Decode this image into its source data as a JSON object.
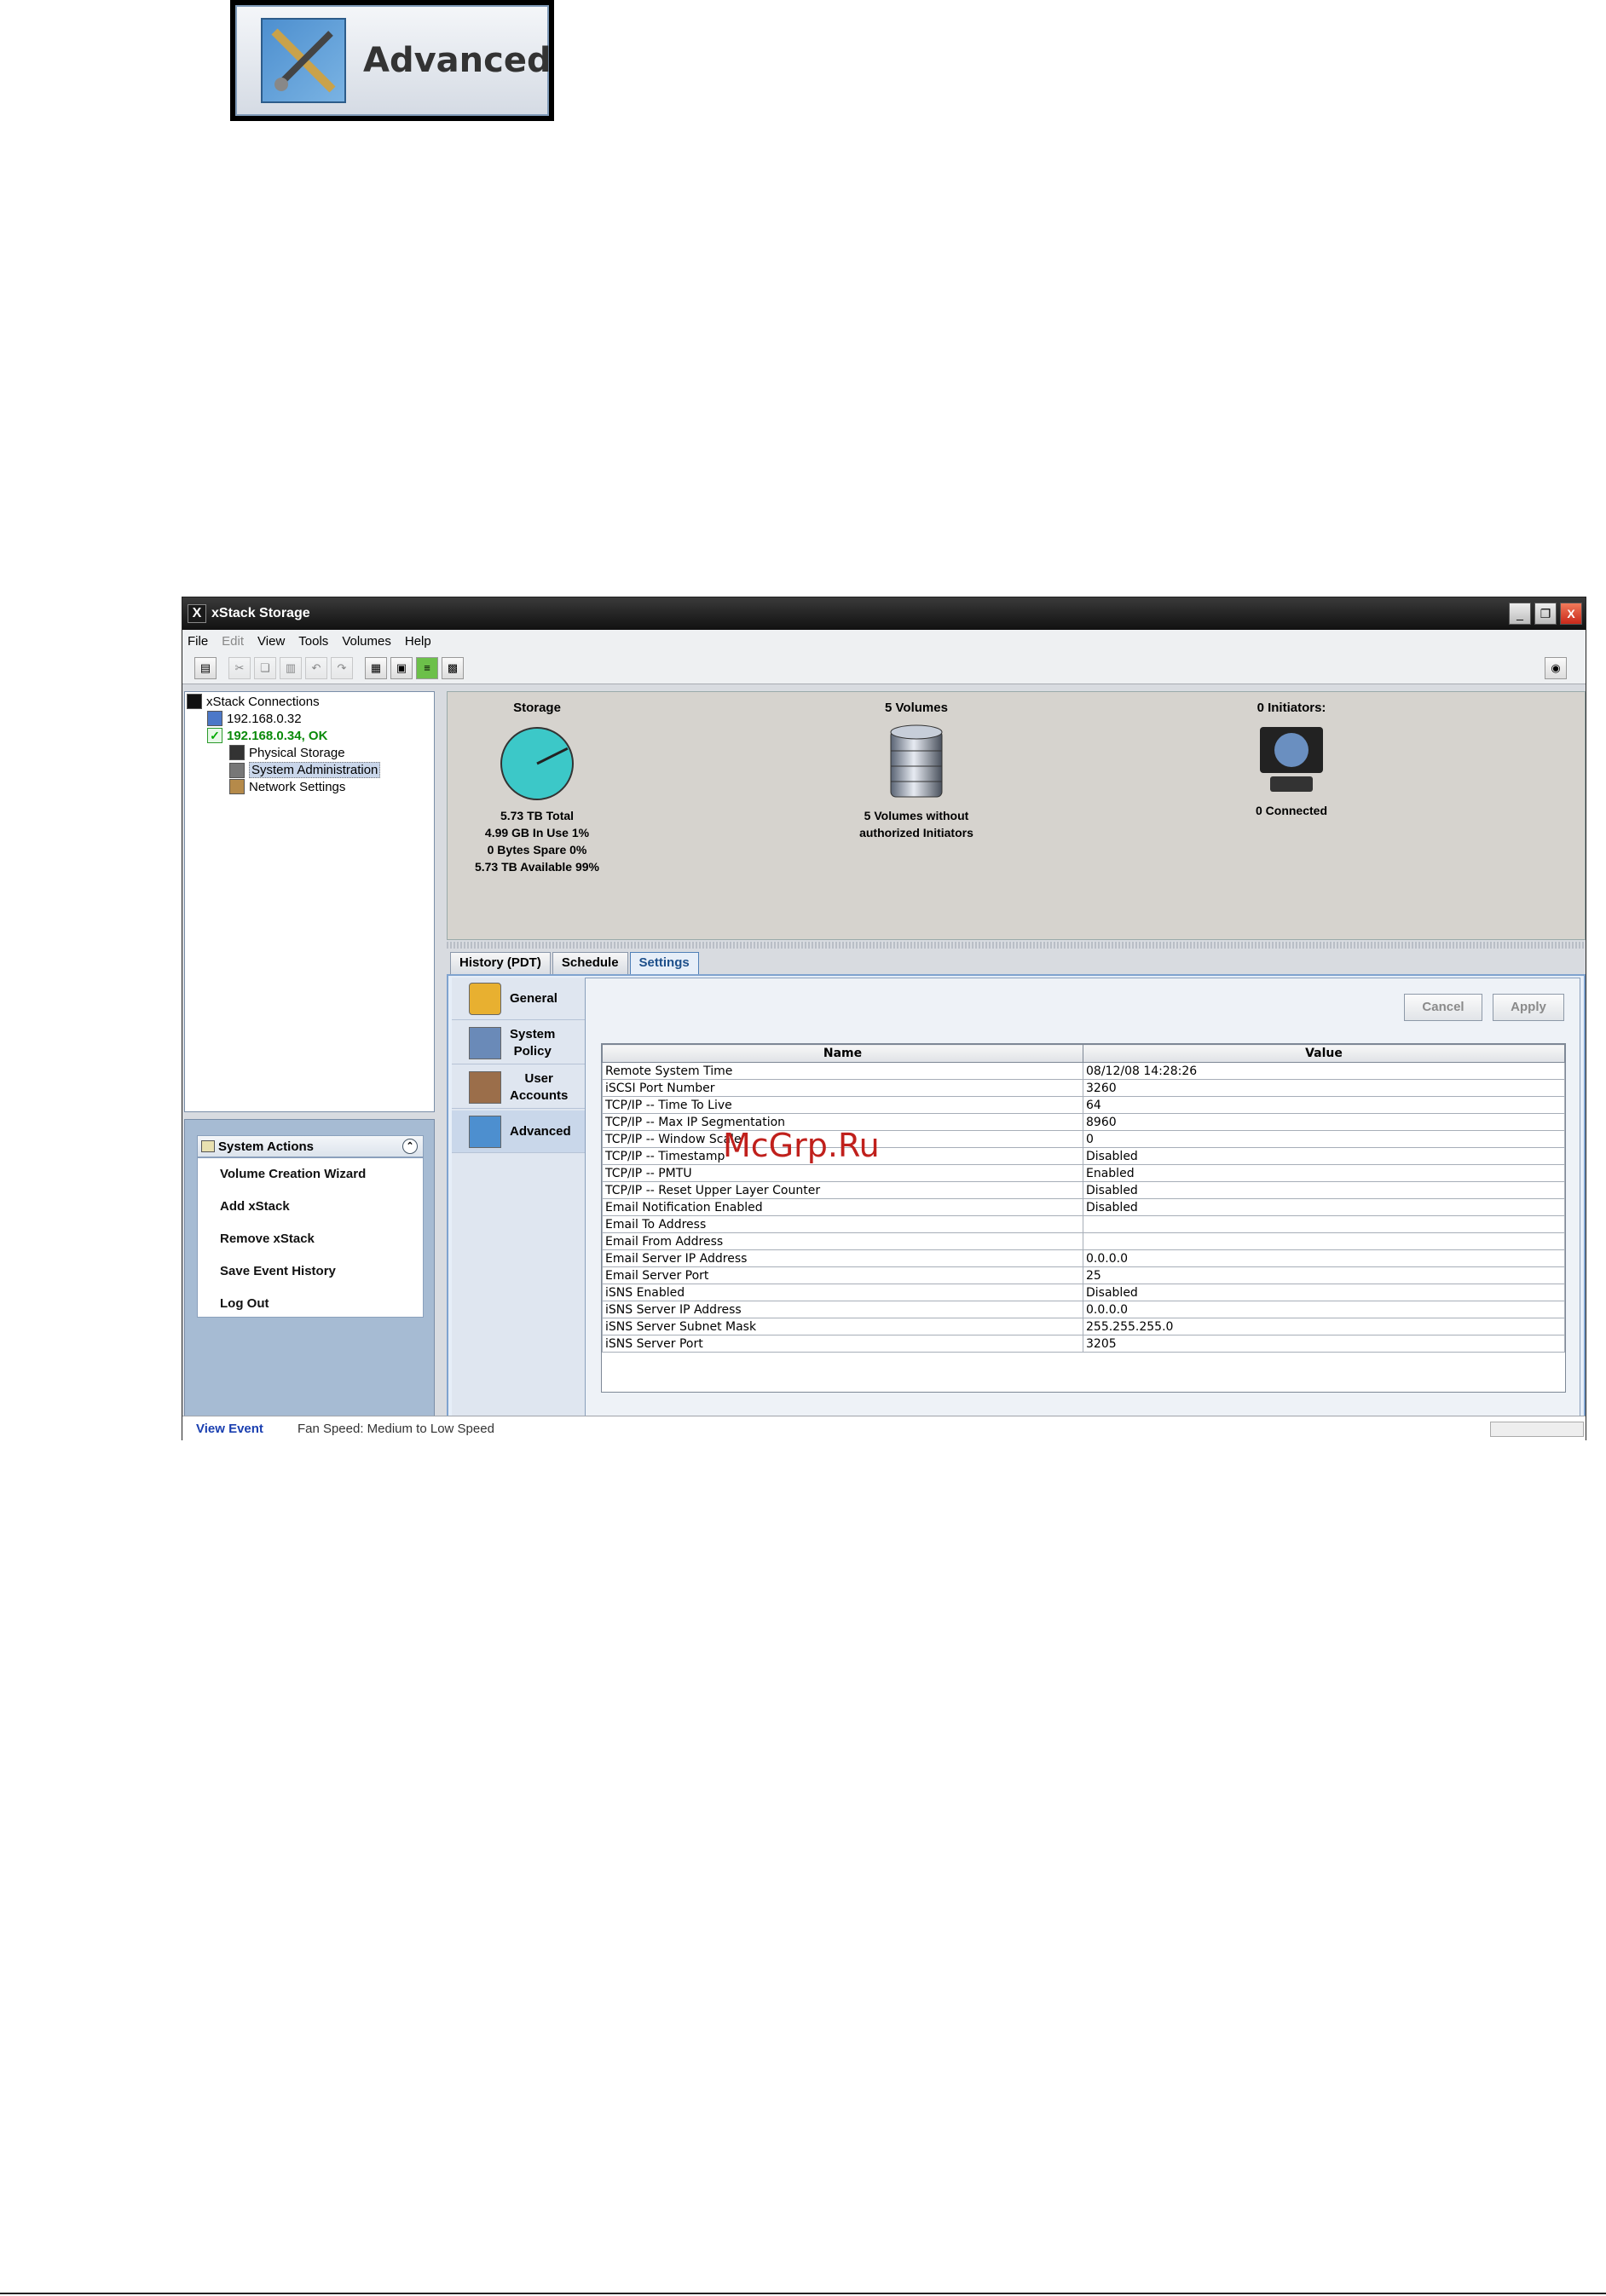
{
  "badge": {
    "label": "Advanced",
    "icon": "tools-icon"
  },
  "window": {
    "title": "xStack Storage",
    "minimize": "_",
    "maximize": "❐",
    "close": "X"
  },
  "menu": {
    "file": "File",
    "edit": "Edit",
    "view": "View",
    "tools": "Tools",
    "volumes": "Volumes",
    "help": "Help"
  },
  "tree": {
    "root": "xStack Connections",
    "n1": "192.168.0.32",
    "n2": "192.168.0.34, OK",
    "n2a": "Physical Storage",
    "n2b": "System Administration",
    "n2c": "Network Settings"
  },
  "actions": {
    "title": "System Actions",
    "items": [
      "Volume Creation Wizard",
      "Add xStack",
      "Remove xStack",
      "Save Event History",
      "Log Out"
    ]
  },
  "summary": {
    "storage": {
      "title": "Storage",
      "lines": [
        "5.73 TB Total",
        "4.99 GB In Use 1%",
        "0 Bytes Spare 0%",
        "5.73 TB Available 99%"
      ],
      "used_fraction": 0.01,
      "color": "#3cc8c8"
    },
    "volumes": {
      "title": "5 Volumes",
      "lines": [
        "5 Volumes without",
        "authorized Initiators"
      ]
    },
    "initiators": {
      "title": "0 Initiators:",
      "lines": [
        "0 Connected"
      ]
    }
  },
  "tabs": [
    "History (PDT)",
    "Schedule",
    "Settings"
  ],
  "side_tabs": {
    "general": "General",
    "system_policy_1": "System",
    "system_policy_2": "Policy",
    "user_accounts_1": "User",
    "user_accounts_2": "Accounts",
    "advanced": "Advanced"
  },
  "buttons": {
    "cancel": "Cancel",
    "apply": "Apply"
  },
  "table": {
    "headers": [
      "Name",
      "Value"
    ],
    "rows": [
      [
        "Remote System Time",
        "08/12/08 14:28:26"
      ],
      [
        "iSCSI Port Number",
        "3260"
      ],
      [
        "TCP/IP -- Time To Live",
        "64"
      ],
      [
        "TCP/IP -- Max IP Segmentation",
        "8960"
      ],
      [
        "TCP/IP -- Window Scale",
        "0"
      ],
      [
        "TCP/IP -- Timestamp",
        "Disabled"
      ],
      [
        "TCP/IP -- PMTU",
        "Enabled"
      ],
      [
        "TCP/IP -- Reset Upper Layer Counter",
        "Disabled"
      ],
      [
        "Email Notification Enabled",
        "Disabled"
      ],
      [
        "Email To Address",
        ""
      ],
      [
        "Email From Address",
        ""
      ],
      [
        "Email Server IP Address",
        "0.0.0.0"
      ],
      [
        "Email Server Port",
        "25"
      ],
      [
        "iSNS Enabled",
        "Disabled"
      ],
      [
        "iSNS Server IP Address",
        "0.0.0.0"
      ],
      [
        "iSNS Server Subnet Mask",
        "255.255.255.0"
      ],
      [
        "iSNS Server Port",
        "3205"
      ]
    ]
  },
  "status": {
    "view_event": "View Event",
    "message": "Fan Speed: Medium to Low Speed"
  },
  "watermark": "McGrp.Ru"
}
